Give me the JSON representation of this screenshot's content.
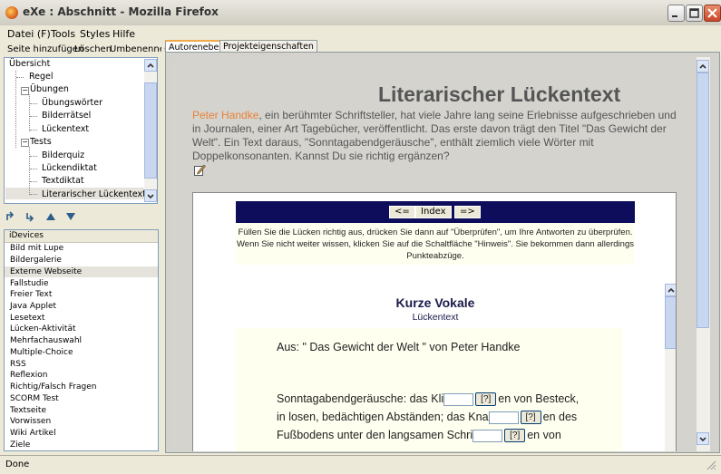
{
  "window": {
    "title": "eXe : Abschnitt - Mozilla Firefox"
  },
  "menu": [
    "Datei (F)",
    "Tools",
    "Styles",
    "Hilfe"
  ],
  "left_toolbar": {
    "add": "Seite hinzufügen",
    "delete": "Löschen",
    "rename": "Umbenennen"
  },
  "tree": {
    "root": "Übersicht",
    "items": [
      "Regel",
      "Übungen",
      "Übungswörter",
      "Bilderrätsel",
      "Lückentext",
      "Tests",
      "Bilderquiz",
      "Lückendiktat",
      "Textdiktat",
      "Literarischer Lückentext"
    ],
    "selected": "Literarischer Lückentext"
  },
  "idevices": {
    "header": "iDevices",
    "items": [
      "Bild mit Lupe",
      "Bildergalerie",
      "Externe Webseite",
      "Fallstudie",
      "Freier Text",
      "Java Applet",
      "Lesetext",
      "Lücken-Aktivität",
      "Mehrfachauswahl",
      "Multiple-Choice",
      "RSS",
      "Reflexion",
      "Richtig/Falsch Fragen",
      "SCORM Test",
      "Textseite",
      "Vorwissen",
      "Wiki Artikel",
      "Ziele"
    ],
    "highlighted": "Externe Webseite"
  },
  "tabs": [
    "Autorenebene",
    "Projekteigenschaften"
  ],
  "content": {
    "title": "Literarischer Lückentext",
    "intro_author": "Peter Handke",
    "intro_rest": ", ein berühmter Schriftsteller, hat viele Jahre lang seine Erlebnisse aufgeschrieben und in Journalen, einer Art Tagebücher, veröffentlicht. Das erste davon trägt den Titel \"Das Gewicht der Welt\". Ein Text daraus, \"Sonntagabendgeräusche\", enthält ziemlich viele Wörter mit Doppelkonsonanten. Kannst Du sie richtig ergänzen?",
    "nav": {
      "prev": "<=",
      "index": "Index",
      "next": "=>"
    },
    "instructions": "Füllen Sie die Lücken richtig aus, drücken Sie dann auf \"Überprüfen\", um Ihre Antworten zu überprüfen. Wenn Sie nicht weiter wissen, klicken Sie auf die Schaltfläche \"Hinweis\". Sie bekommen dann allerdings Punkteabzüge.",
    "section_title": "Kurze Vokale",
    "section_subtitle": "Lückentext",
    "source": "Aus: \" Das Gewicht der Welt \" von Peter Handke",
    "hint_label": "[?]",
    "lines": [
      {
        "before": "Sonntagabendgeräusche: das Kli",
        "after": "en von Besteck,"
      },
      {
        "before": "in losen, bedächtigen Abständen; das Kna",
        "after": "en des"
      },
      {
        "before": "Fußbodens unter den langsamen Schri",
        "after": "en von"
      }
    ]
  },
  "status": "Done"
}
